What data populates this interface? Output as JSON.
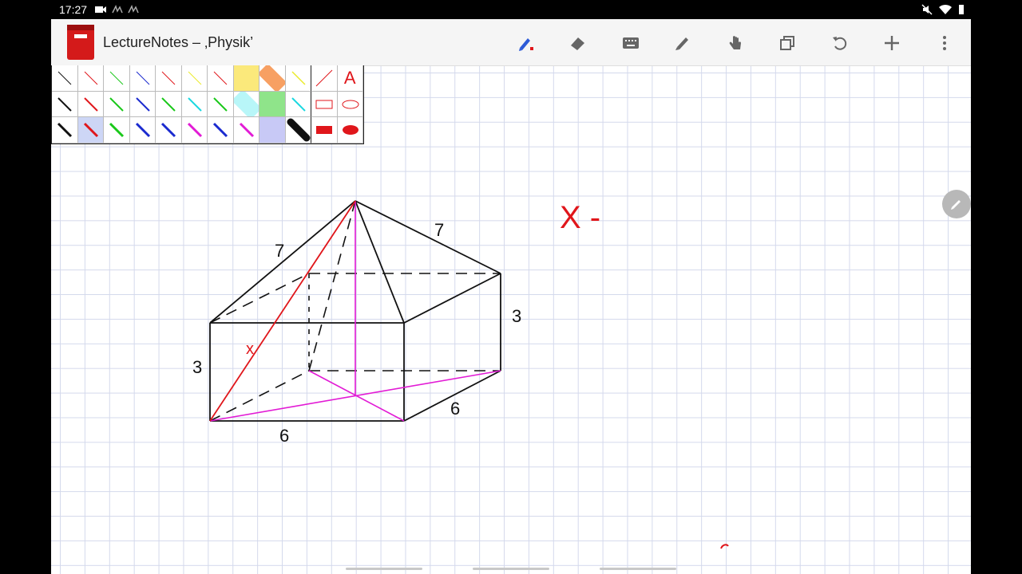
{
  "status_bar": {
    "time": "17:27"
  },
  "app": {
    "title": "LectureNotes – ‚Physik’",
    "toolbar": [
      "pen-icon",
      "eraser-icon",
      "keyboard-icon",
      "highlighter-icon",
      "hand-icon",
      "copy-icon",
      "undo-icon",
      "add-icon",
      "more-icon"
    ]
  },
  "palette": {
    "text_tool_label": "A"
  },
  "drawing": {
    "labels": {
      "edge_top_left": "7",
      "edge_top_right": "7",
      "height_left": "3",
      "height_right": "3",
      "base_front": "6",
      "base_side": "6",
      "diagonal_x": "x"
    },
    "note": "X -"
  },
  "colors": {
    "ink_black": "#111111",
    "ink_red": "#e0161b",
    "ink_magenta": "#e21bd5",
    "grid": "#d4d9ec"
  }
}
